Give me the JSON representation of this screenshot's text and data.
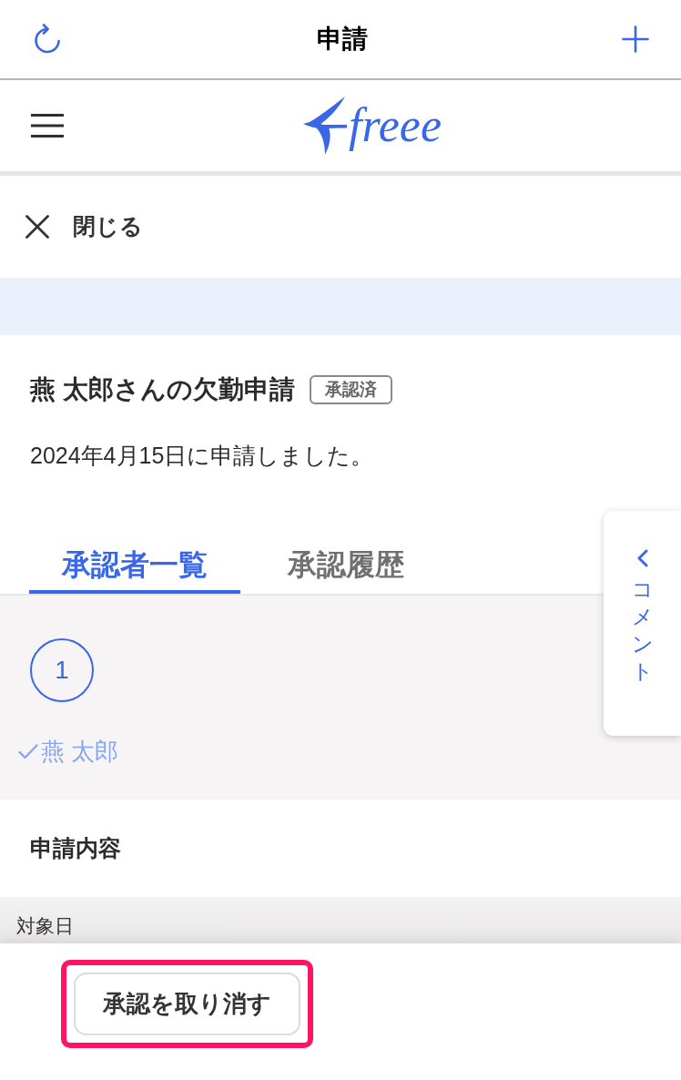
{
  "header": {
    "title": "申請"
  },
  "logo": {
    "text": "freee"
  },
  "close": {
    "label": "閉じる"
  },
  "request": {
    "title": "燕 太郎さんの欠勤申請",
    "status_badge": "承認済",
    "submitted": "2024年4月15日に申請しました。"
  },
  "tabs": [
    {
      "label": "承認者一覧",
      "selected": true
    },
    {
      "label": "承認履歴",
      "selected": false
    }
  ],
  "approval_steps": [
    {
      "step": "1",
      "approvers": [
        {
          "name": "燕 太郎",
          "approved": true
        }
      ]
    }
  ],
  "details": {
    "heading": "申請内容",
    "fields": [
      {
        "label": "対象日"
      }
    ]
  },
  "comment_tab": {
    "label": "コメント"
  },
  "footer": {
    "buttons": [
      {
        "label": "承認を取り消す",
        "highlighted": true
      }
    ]
  }
}
